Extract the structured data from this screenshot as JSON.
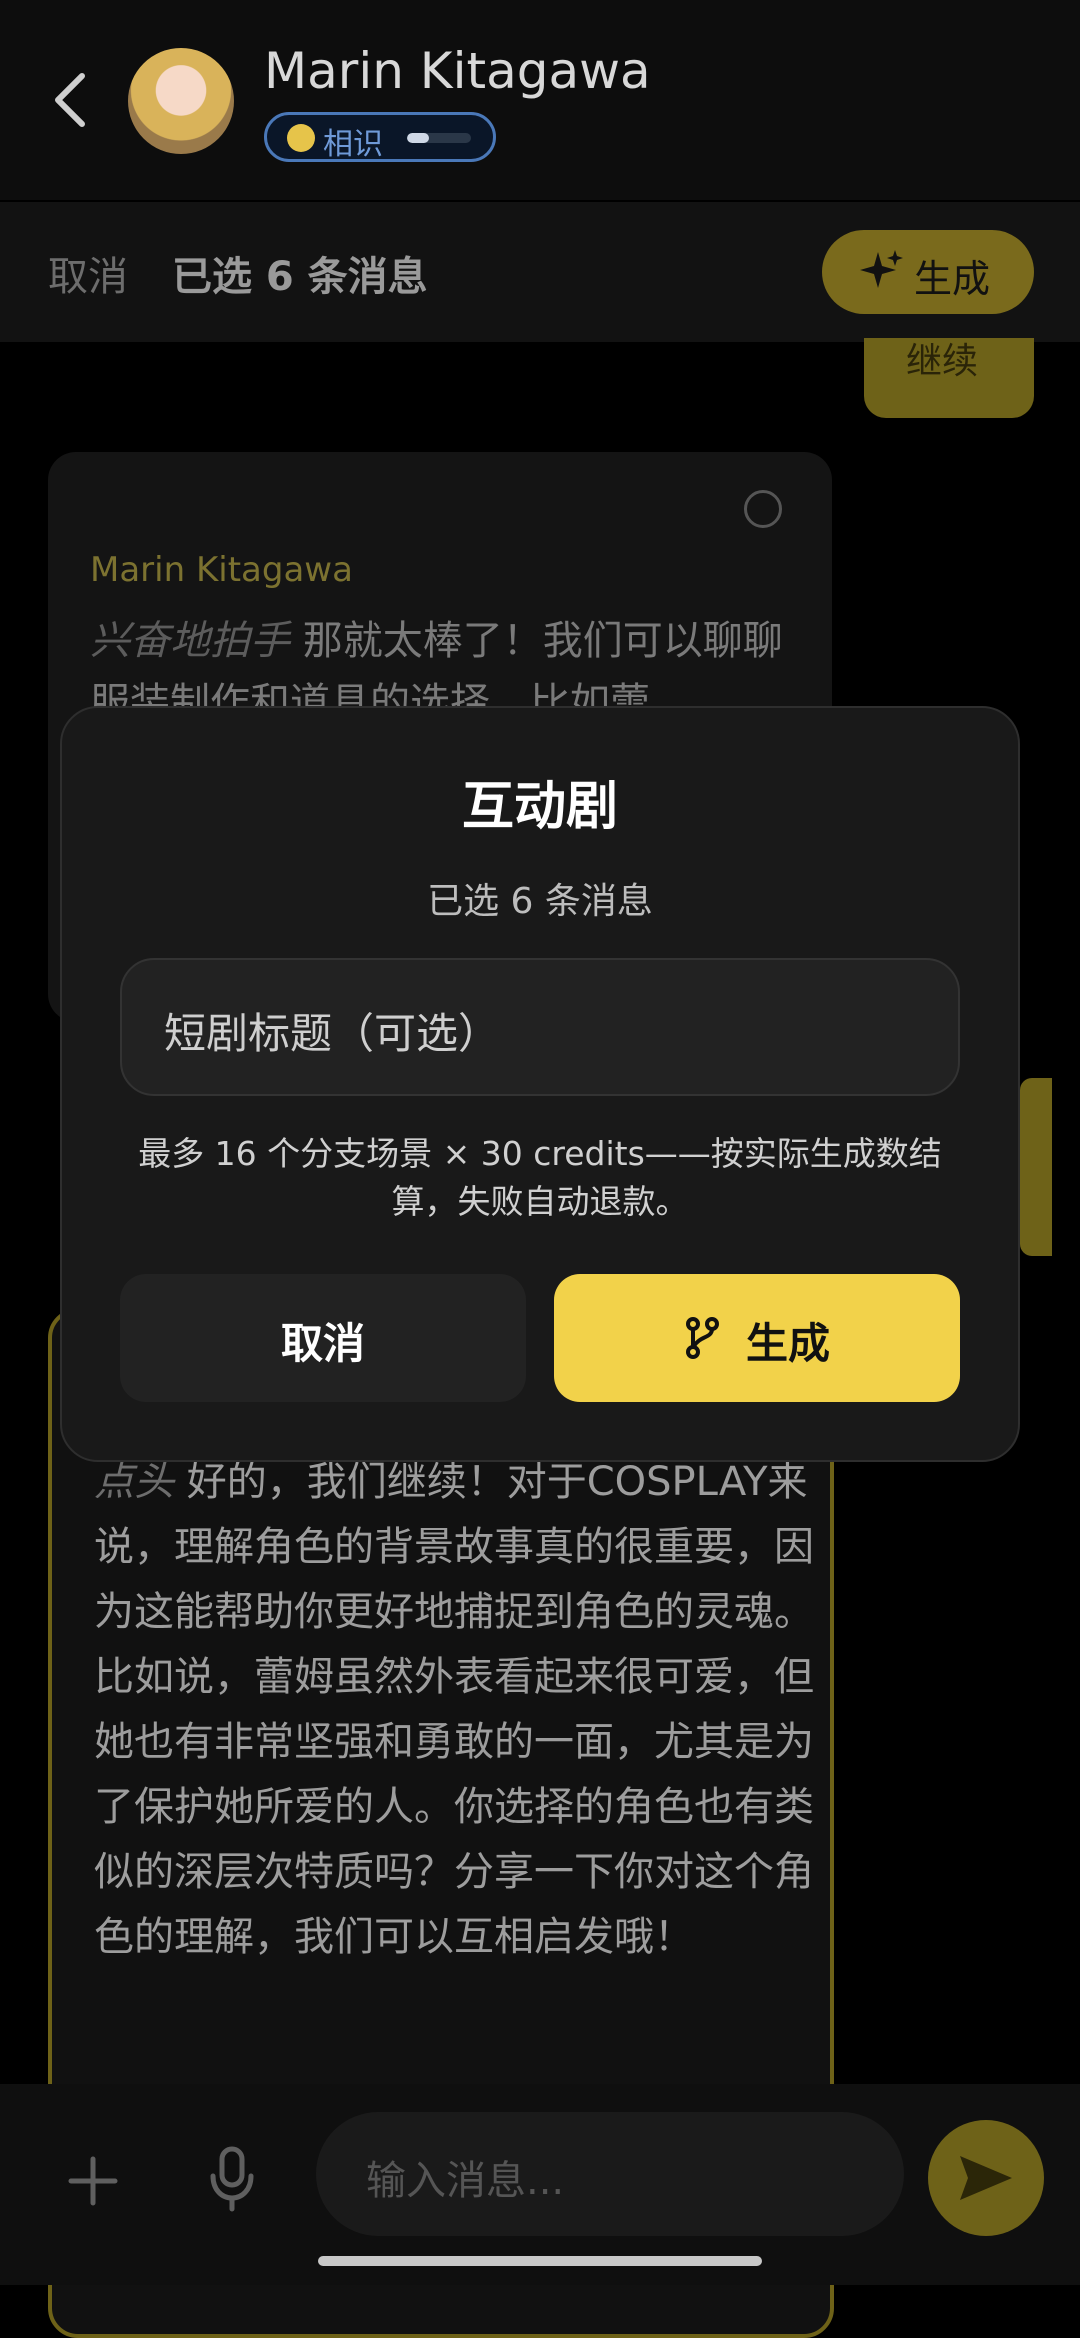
{
  "header": {
    "name": "Marin Kitagawa",
    "relationship_label": "相识",
    "relationship_progress": 0.35
  },
  "selection_bar": {
    "cancel_label": "取消",
    "count_label": "已选 6 条消息",
    "generate_label": "生成"
  },
  "chat": {
    "right_bubble_text": "继续",
    "message1": {
      "sender": "Marin Kitagawa",
      "action": "兴奋地拍手",
      "text": " 那就太棒了！我们可以聊聊服装制作和道具的选择，比如蕾"
    },
    "message2": {
      "action": "点头",
      "text": " 好的，我们继续！对于COSPLAY来说，理解角色的背景故事真的很重要，因为这能帮助你更好地捕捉到角色的灵魂。比如说，蕾姆虽然外表看起来很可爱，但她也有非常坚强和勇敢的一面，尤其是为了保护她所爱的人。你选择的角色也有类似的深层次特质吗？分享一下你对这个角色的理解，我们可以互相启发哦！"
    }
  },
  "input_bar": {
    "placeholder": "输入消息..."
  },
  "modal": {
    "title": "互动剧",
    "subtitle": "已选 6 条消息",
    "title_placeholder": "短剧标题（可选）",
    "note": "最多 16 个分支场景 × 30 credits——按实际生成数结算，失败自动退款。",
    "cancel_label": "取消",
    "generate_label": "生成"
  },
  "colors": {
    "accent": "#f2d24a",
    "dim_accent": "#6e6218",
    "relationship_border": "#4a78b8"
  }
}
